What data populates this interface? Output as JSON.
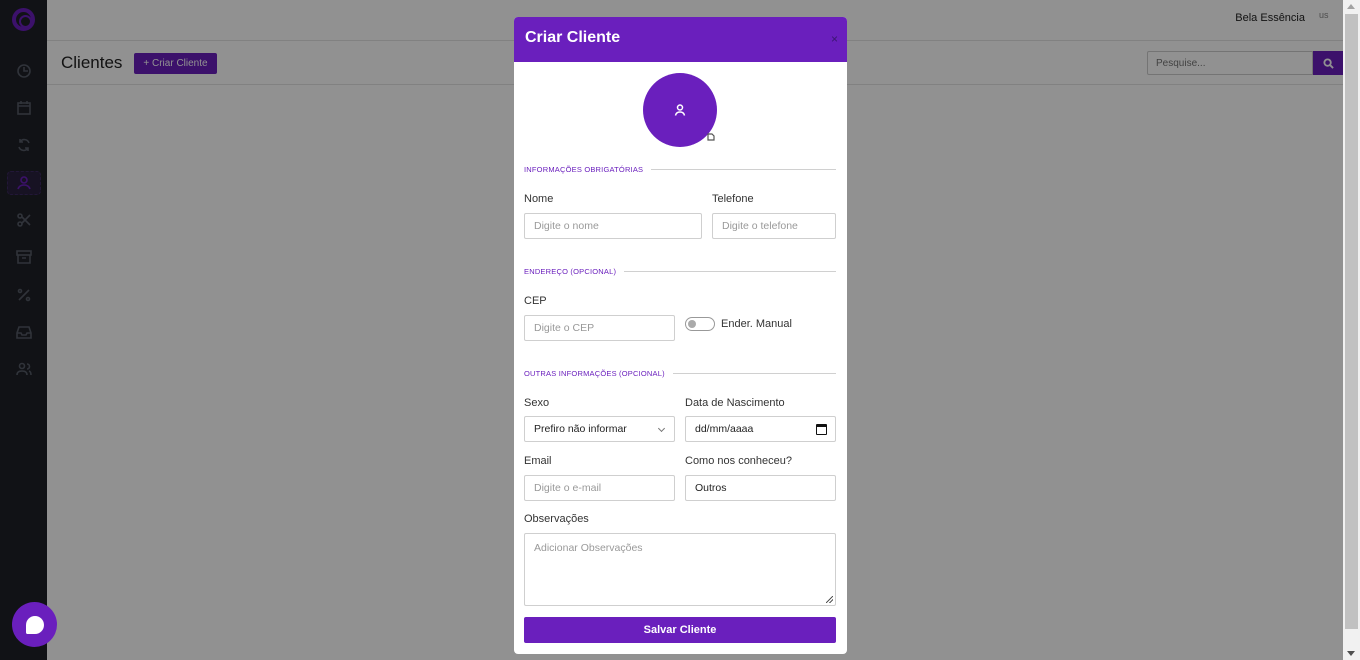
{
  "app": {
    "business_name": "Bela Essência",
    "user_image_alt": "us"
  },
  "sidebar": {
    "items": [
      {
        "icon": "clock-icon",
        "active": false
      },
      {
        "icon": "calendar-icon",
        "active": false
      },
      {
        "icon": "refresh-icon",
        "active": false
      },
      {
        "icon": "user-icon",
        "active": true
      },
      {
        "icon": "scissors-icon",
        "active": false
      },
      {
        "icon": "archive-icon",
        "active": false
      },
      {
        "icon": "percent-icon",
        "active": false
      },
      {
        "icon": "inbox-icon",
        "active": false
      },
      {
        "icon": "users-icon",
        "active": false
      }
    ]
  },
  "page": {
    "title": "Clientes",
    "create_button": "+ Criar Cliente",
    "search_placeholder": "Pesquise..."
  },
  "modal": {
    "title": "Criar Cliente",
    "close": "×",
    "sections": {
      "required": "INFORMAÇÕES OBRIGATÓRIAS",
      "address": "ENDEREÇO (OPCIONAL)",
      "other": "OUTRAS INFORMAÇÕES (OPCIONAL)"
    },
    "fields": {
      "name_label": "Nome",
      "name_placeholder": "Digite o nome",
      "phone_label": "Telefone",
      "phone_placeholder": "Digite o telefone",
      "cep_label": "CEP",
      "cep_placeholder": "Digite o CEP",
      "manual_address_label": "Ender. Manual",
      "manual_address_on": false,
      "gender_label": "Sexo",
      "gender_value": "Prefiro não informar",
      "birth_label": "Data de Nascimento",
      "birth_value": "dd/mm/aaaa",
      "email_label": "Email",
      "email_placeholder": "Digite o e-mail",
      "source_label": "Como nos conheceu?",
      "source_value": "Outros",
      "notes_label": "Observações",
      "notes_placeholder": "Adicionar Observações"
    },
    "submit": "Salvar Cliente"
  },
  "colors": {
    "accent": "#6a1fbd",
    "sidebar": "#1f2128"
  }
}
